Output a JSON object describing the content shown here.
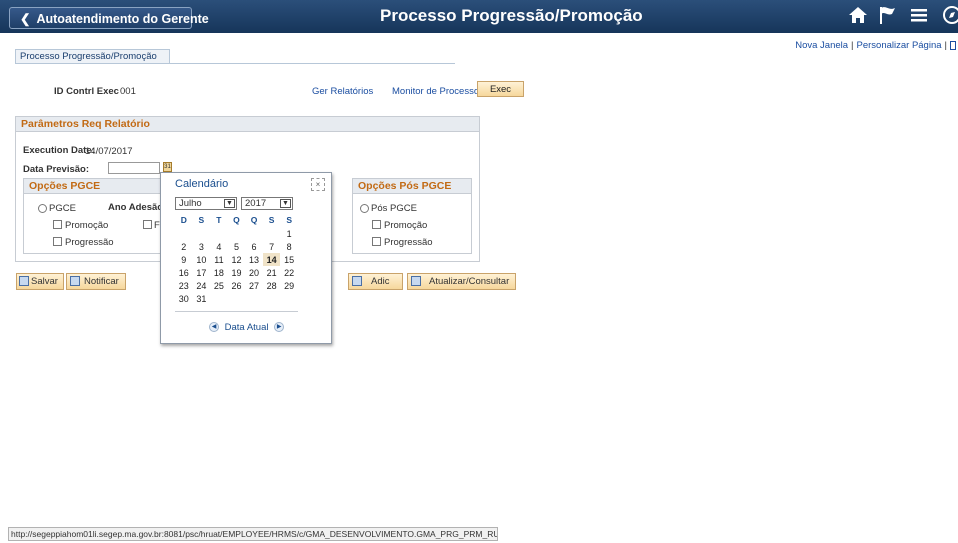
{
  "header": {
    "back_label": "Autoatendimento do Gerente",
    "title": "Processo Progressão/Promoção",
    "icons": [
      "home-icon",
      "flag-icon",
      "menu-icon",
      "compass-icon"
    ]
  },
  "toplinks": {
    "nova_janela": "Nova Janela",
    "separator": "|",
    "personalizar": "Personalizar Página"
  },
  "tab": {
    "label": "Processo Progressão/Promoção"
  },
  "run_control": {
    "id_label": "ID Contrl Exec",
    "id_value": "001",
    "ger_relatorios": "Ger Relatórios",
    "monitor": "Monitor de Processos",
    "exec_button": "Exec"
  },
  "params": {
    "title": "Parâmetros Req Relatório",
    "execution_date_label": "Execution Date:",
    "execution_date_value": "14/07/2017",
    "data_previsao_label": "Data Previsão:",
    "opcoes_pgce": {
      "title": "Opções PGCE",
      "pgce_label": "PGCE",
      "ano_adesao_label": "Ano Adesão",
      "promocao_label": "Promoção",
      "progressao_label": "Progressão",
      "partial_f": "F"
    },
    "opcoes_pos_pgce": {
      "title": "Opções Pós PGCE",
      "pos_pgce_label": "Pós PGCE",
      "promocao_label": "Promoção",
      "progressao_label": "Progressão"
    }
  },
  "buttons": {
    "salvar": "Salvar",
    "notificar": "Notificar",
    "adic": "Adic",
    "atualizar": "Atualizar/Consultar"
  },
  "calendar": {
    "title": "Calendário",
    "close": "×",
    "month": "Julho",
    "year": "2017",
    "weekdays": [
      "D",
      "S",
      "T",
      "Q",
      "Q",
      "S",
      "S"
    ],
    "weeks": [
      [
        "",
        "",
        "",
        "",
        "",
        "",
        "1"
      ],
      [
        "2",
        "3",
        "4",
        "5",
        "6",
        "7",
        "8"
      ],
      [
        "9",
        "10",
        "11",
        "12",
        "13",
        "14",
        "15"
      ],
      [
        "16",
        "17",
        "18",
        "19",
        "20",
        "21",
        "22"
      ],
      [
        "23",
        "24",
        "25",
        "26",
        "27",
        "28",
        "29"
      ],
      [
        "30",
        "31",
        "",
        "",
        "",
        "",
        ""
      ]
    ],
    "today": "14",
    "data_atual": "Data Atual"
  },
  "statusbar": {
    "url": "http://segeppiahom01li.segep.ma.gov.br:8081/psc/hruat/EMPLOYEE/HRMS/c/GMA_DESENVOLVIMENTO.GMA_PRG_PRM_RU..."
  },
  "colors": {
    "header_bg": "#1f3f68",
    "section_title": "#c26a14",
    "link": "#1b4ea1",
    "button_bg": "#f6d79c"
  }
}
